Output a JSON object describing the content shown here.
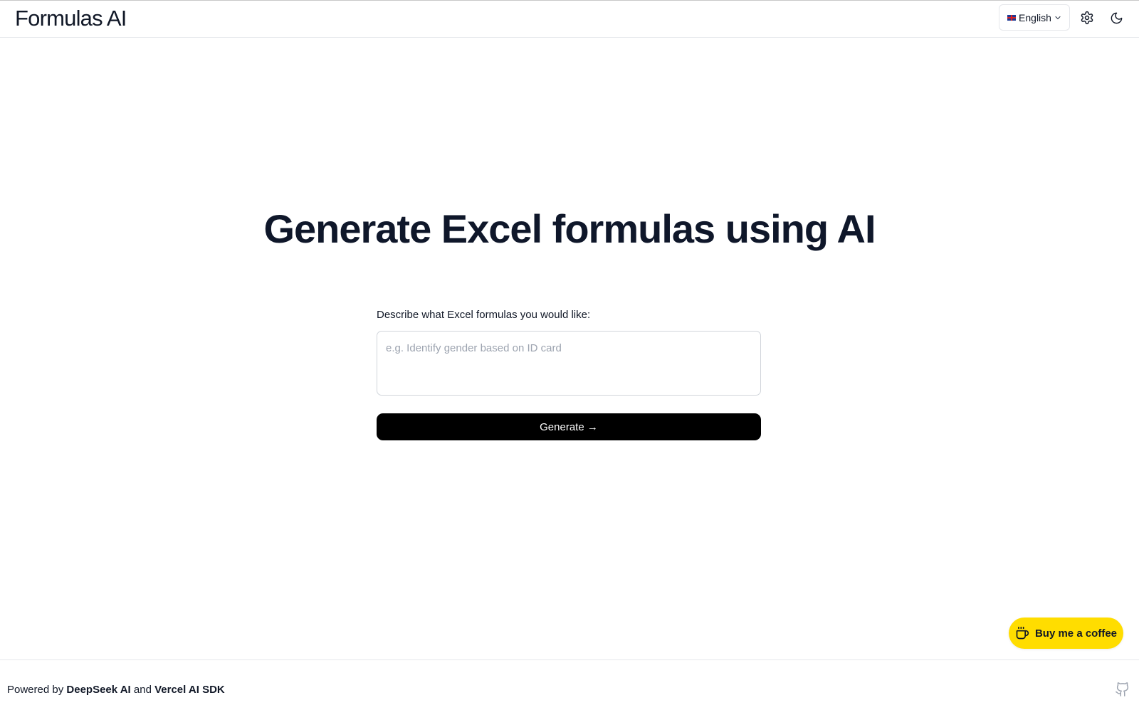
{
  "header": {
    "brand": "Formulas AI",
    "language_label": "English",
    "icons": {
      "language": "flag-uk-icon",
      "dropdown": "chevron-down-icon",
      "settings": "gear-icon",
      "theme": "moon-icon"
    }
  },
  "main": {
    "headline": "Generate Excel formulas using AI",
    "prompt_label": "Describe what Excel formulas you would like:",
    "prompt_value": "",
    "prompt_placeholder": "e.g. Identify gender based on ID card",
    "generate_label": "Generate →"
  },
  "coffee": {
    "label": "Buy me a coffee",
    "icon": "coffee-cup-icon",
    "color": "#ffdd00"
  },
  "footer": {
    "powered_prefix": "Powered by",
    "provider_1": "DeepSeek AI",
    "joiner": "and",
    "provider_2": "Vercel AI SDK",
    "github_icon": "github-icon"
  },
  "colors": {
    "text": "#0f172a",
    "button_bg": "#000000",
    "border": "#e5e7eb"
  }
}
